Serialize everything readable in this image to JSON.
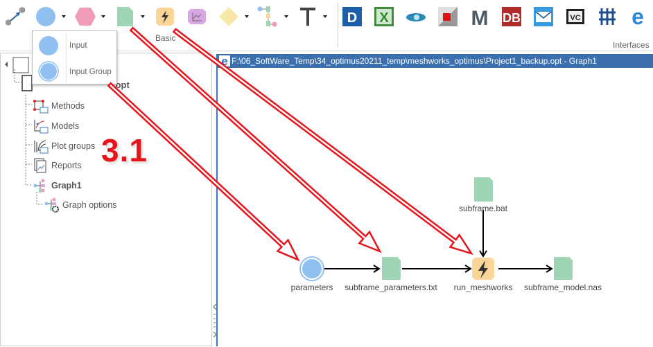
{
  "ribbon": {
    "basic_group_label": "Basic",
    "interfaces_group_label": "Interfaces",
    "basic_tools": [
      "connector-icon",
      "input-circle-icon",
      "hexagon-icon",
      "document-icon",
      "action-lightning-icon",
      "chart-node-icon",
      "decision-diamond-icon",
      "workflow-icon",
      "text-T-icon"
    ],
    "interface_tools": [
      "dassault-icon",
      "excel-icon",
      "eye-icon",
      "red-square-icon",
      "matlab-M-icon",
      "db-icon",
      "mail-icon",
      "vc-icon",
      "abacus-icon",
      "e-icon"
    ]
  },
  "popup": {
    "items": [
      {
        "label": "Input",
        "icon": "input-circle-icon"
      },
      {
        "label": "Input Group",
        "icon": "input-group-circle-icon"
      }
    ]
  },
  "tree": {
    "project_suffix": ".opt",
    "items": [
      {
        "label": "Methods",
        "icon": "methods-icon"
      },
      {
        "label": "Models",
        "icon": "models-icon"
      },
      {
        "label": "Plot groups",
        "icon": "plot-groups-icon"
      },
      {
        "label": "Reports",
        "icon": "reports-icon"
      },
      {
        "label": "Graph1",
        "icon": "graph-icon"
      },
      {
        "label": "Graph options",
        "icon": "graph-options-icon"
      }
    ]
  },
  "annotation": {
    "step": "3.1",
    "color": "#e8141c"
  },
  "graph_window": {
    "title": "F:\\06_SoftWare_Temp\\34_optimus20211_temp\\meshworks_optimus\\Project1_backup.opt - Graph1",
    "nodes": [
      {
        "id": "parameters",
        "label": "parameters",
        "type": "input-group"
      },
      {
        "id": "subframe_parameters",
        "label": "subframe_parameters.txt",
        "type": "file"
      },
      {
        "id": "run_meshworks",
        "label": "run_meshworks",
        "type": "action"
      },
      {
        "id": "subframe_model",
        "label": "subframe_model.nas",
        "type": "file"
      },
      {
        "id": "subframe_bat",
        "label": "subframe.bat",
        "type": "file"
      }
    ],
    "edges": [
      [
        "parameters",
        "subframe_parameters"
      ],
      [
        "subframe_parameters",
        "run_meshworks"
      ],
      [
        "run_meshworks",
        "subframe_model"
      ],
      [
        "subframe_bat",
        "run_meshworks"
      ]
    ]
  },
  "colors": {
    "input": "#8fc0ef",
    "file": "#9fd4b4",
    "action": "#f9d597",
    "hexagon": "#f19cb6",
    "chart": "#d8a6e0",
    "diamond": "#f6e6a8",
    "titlebar": "#3c6fae"
  }
}
